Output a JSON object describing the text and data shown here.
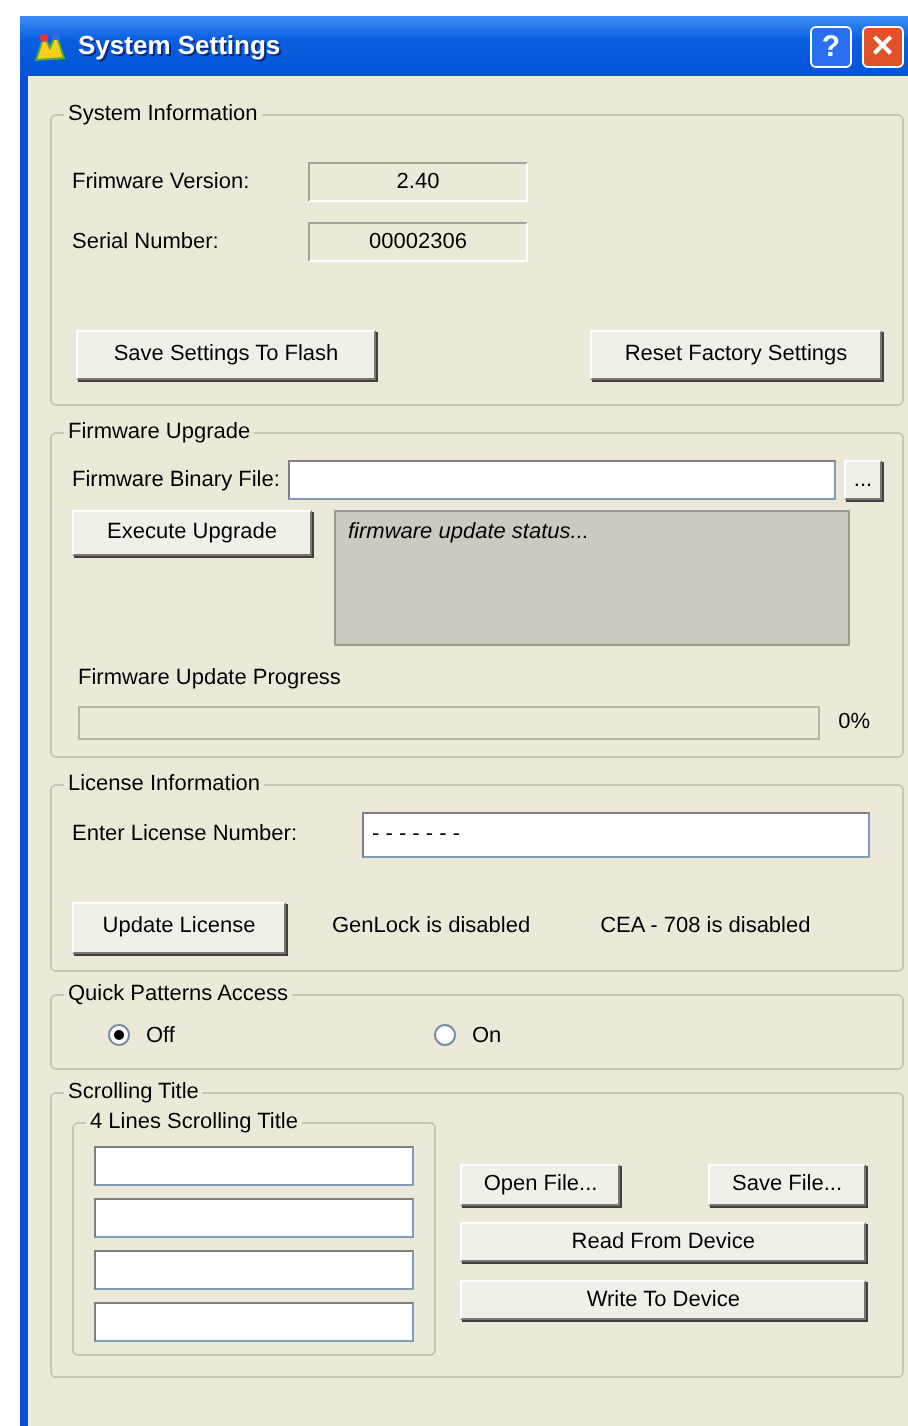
{
  "window": {
    "title": "System Settings",
    "help_button": "?",
    "close_button": "✕"
  },
  "system_information": {
    "title": "System Information",
    "fields": [
      {
        "label": "Frimware Version:",
        "value": "2.40"
      },
      {
        "label": "Serial Number:",
        "value": "00002306"
      }
    ],
    "buttons": [
      "Save Settings To Flash",
      "Reset Factory Settings"
    ]
  },
  "firmware_upgrade": {
    "title": "Firmware Upgrade",
    "file_label": "Firmware Binary File:",
    "browse_button": "...",
    "execute_button": "Execute Upgrade",
    "status": "firmware update status...",
    "progress_label": "Firmware Update Progress",
    "progress": {
      "level": 0,
      "reading": "0%"
    }
  },
  "license_information": {
    "title": "License Information",
    "label": "Enter License Number:",
    "value": "- - - - - - -",
    "button": "Update License",
    "statuses": [
      "GenLock is disabled",
      "CEA - 708 is disabled"
    ]
  },
  "quick_patterns_access": {
    "title": "Quick Patterns Access",
    "options": [
      {
        "label": "Off",
        "selected": true
      },
      {
        "label": "On",
        "selected": false
      }
    ]
  },
  "scrolling_title": {
    "title": "Scrolling Title",
    "lines_group": {
      "title": "4 Lines Scrolling Title",
      "lines": [
        {
          "kind": "text-field"
        },
        {
          "kind": "text-field"
        },
        {
          "kind": "text-field"
        },
        {
          "kind": "text-field"
        }
      ]
    },
    "open_button": "Open File...",
    "save_button": "Save File...",
    "read_button": "Read From Device",
    "write_button": "Write To Device"
  }
}
